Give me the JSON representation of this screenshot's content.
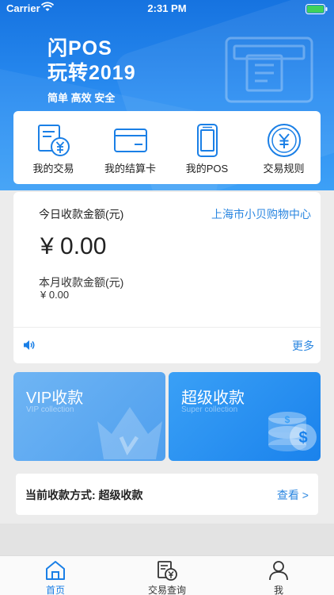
{
  "status_bar": {
    "carrier": "Carrier",
    "time": "2:31 PM"
  },
  "banner": {
    "title_line1": "闪POS",
    "title_line2": "玩转2019",
    "subtitle": "简单 高效 安全"
  },
  "quick_menu": [
    {
      "label": "我的交易",
      "icon": "transaction-icon"
    },
    {
      "label": "我的结算卡",
      "icon": "card-icon"
    },
    {
      "label": "我的POS",
      "icon": "pos-icon"
    },
    {
      "label": "交易规则",
      "icon": "yuan-icon"
    }
  ],
  "income": {
    "today_label": "今日收款金额(元)",
    "shop_name": "上海市小贝购物中心",
    "today_amount": "¥ 0.00",
    "month_label": "本月收款金额(元)",
    "month_amount": "¥ 0.00",
    "more_label": "更多"
  },
  "promos": {
    "vip": {
      "title": "VIP收款",
      "subtitle": "VIP collection"
    },
    "super": {
      "title": "超级收款",
      "subtitle": "Super collection"
    }
  },
  "payment_method": {
    "text": "当前收款方式: 超级收款",
    "link": "查看 >"
  },
  "tabbar": [
    {
      "label": "首页",
      "icon": "home-icon",
      "active": true
    },
    {
      "label": "交易查询",
      "icon": "query-icon",
      "active": false
    },
    {
      "label": "我",
      "icon": "user-icon",
      "active": false
    }
  ],
  "colors": {
    "brand_blue": "#1a7fe6",
    "link_blue": "#2a86e0",
    "active_tab": "#1a7fe6",
    "inactive_tab": "#333333"
  }
}
